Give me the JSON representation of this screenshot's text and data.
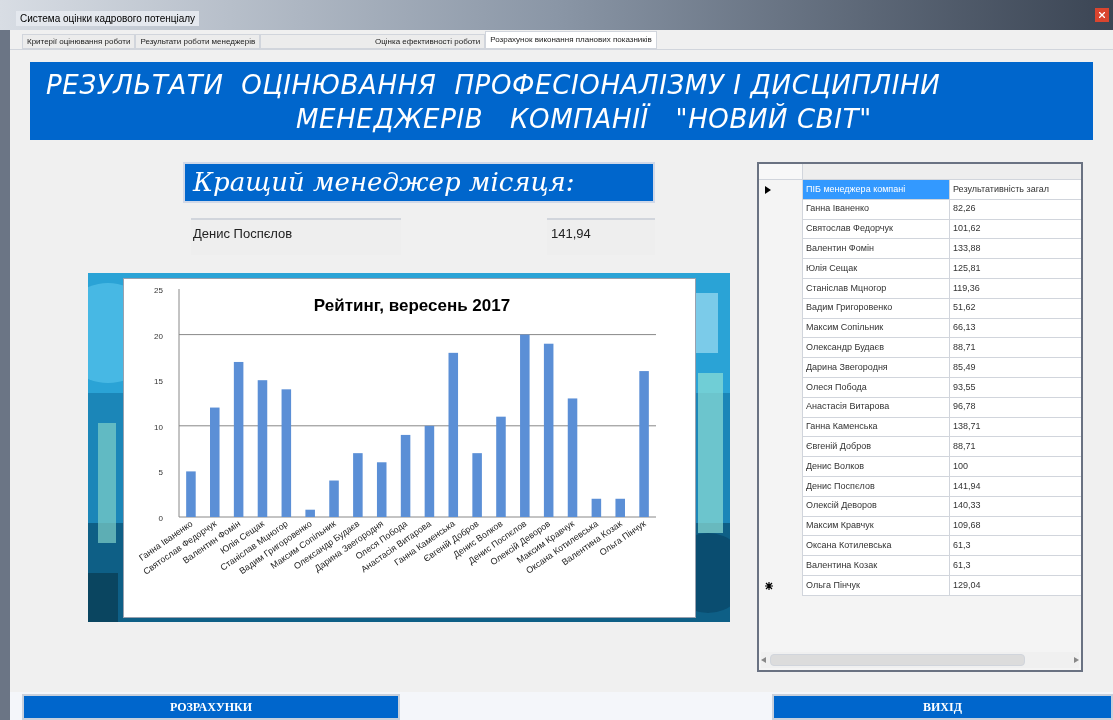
{
  "window": {
    "title": "Система оцінки кадрового потенціалу"
  },
  "tabs": [
    {
      "label": "Критерії оцінювання роботи",
      "selected": false
    },
    {
      "label": "Результати роботи менеджерів",
      "selected": false
    },
    {
      "label": "Оцінка ефективності роботи",
      "selected": false
    },
    {
      "label": "Розрахунок виконання планових показників",
      "selected": true
    }
  ],
  "banner": {
    "line_1": "РЕЗУЛЬТАТИ  ОЦІНЮВАННЯ  ПРОФЕСІОНАЛІЗМУ І ДИСЦИПЛІНИ",
    "line_2": "МЕНЕДЖЕРІВ   КОМПАНІЇ   \"НОВИЙ СВІТ\""
  },
  "best_manager": {
    "heading": "Кращий менеджер місяця:",
    "name": "Денис Поспєлов",
    "score": "141,94"
  },
  "chart": {
    "chart_data": {
      "type": "bar",
      "title": "Рейтинг, вересень 2017",
      "categories": [
        "Ганна Іваненко",
        "Святослав Федорчук",
        "Валентин Фомін",
        "Юлія Сещак",
        "Станіслав Мцногор",
        "Вадим Григоровенко",
        "Максим Сопільник",
        "Олександр Будаєв",
        "Дарина Звегородня",
        "Олеся Побода",
        "Анастасія Витарова",
        "Ганна Каменська",
        "Євгеній Добров",
        "Денис Волков",
        "Денис Поспєлов",
        "Олексій Деворов",
        "Максим Кравчук",
        "Оксана Котилевська",
        "Валентина Козак",
        "Ольга Пінчук"
      ],
      "series": [
        {
          "color": "#5b8fd6",
          "values": [
            5,
            12,
            17,
            15,
            14,
            0.8,
            4,
            7,
            6,
            9,
            10,
            18,
            7,
            11,
            20,
            19,
            13,
            2,
            2,
            16
          ]
        }
      ],
      "ylim": [
        0,
        25
      ],
      "yticks": [
        0,
        5,
        10,
        15,
        20,
        25
      ]
    }
  },
  "table": {
    "rows": [
      {
        "current": true,
        "new_row": false,
        "name": "ПІБ менеджера компані",
        "value": "Результативність загал",
        "selected": true
      },
      {
        "current": false,
        "new_row": false,
        "name": "Ганна Іваненко",
        "value": "82,26",
        "selected": false
      },
      {
        "current": false,
        "new_row": false,
        "name": "Святослав Федорчук",
        "value": "101,62",
        "selected": false
      },
      {
        "current": false,
        "new_row": false,
        "name": "Валентин Фомін",
        "value": "133,88",
        "selected": false
      },
      {
        "current": false,
        "new_row": false,
        "name": "Юлія Сещак",
        "value": "125,81",
        "selected": false
      },
      {
        "current": false,
        "new_row": false,
        "name": "Станіслав Мцногор",
        "value": "119,36",
        "selected": false
      },
      {
        "current": false,
        "new_row": false,
        "name": "Вадим Григоровенко",
        "value": "51,62",
        "selected": false
      },
      {
        "current": false,
        "new_row": false,
        "name": "Максим Сопільник",
        "value": "66,13",
        "selected": false
      },
      {
        "current": false,
        "new_row": false,
        "name": "Олександр Будаєв",
        "value": "88,71",
        "selected": false
      },
      {
        "current": false,
        "new_row": false,
        "name": "Дарина Звегородня",
        "value": "85,49",
        "selected": false
      },
      {
        "current": false,
        "new_row": false,
        "name": "Олеся Побода",
        "value": "93,55",
        "selected": false
      },
      {
        "current": false,
        "new_row": false,
        "name": "Анастасія Витарова",
        "value": "96,78",
        "selected": false
      },
      {
        "current": false,
        "new_row": false,
        "name": "Ганна Каменська",
        "value": "138,71",
        "selected": false
      },
      {
        "current": false,
        "new_row": false,
        "name": "Євгеній Добров",
        "value": "88,71",
        "selected": false
      },
      {
        "current": false,
        "new_row": false,
        "name": "Денис Волков",
        "value": "100",
        "selected": false
      },
      {
        "current": false,
        "new_row": false,
        "name": "Денис Поспєлов",
        "value": "141,94",
        "selected": false
      },
      {
        "current": false,
        "new_row": false,
        "name": "Олексій Деворов",
        "value": "140,33",
        "selected": false
      },
      {
        "current": false,
        "new_row": false,
        "name": "Максим Кравчук",
        "value": "109,68",
        "selected": false
      },
      {
        "current": false,
        "new_row": false,
        "name": "Оксана Котилевська",
        "value": "61,3",
        "selected": false
      },
      {
        "current": false,
        "new_row": false,
        "name": "Валентина Козак",
        "value": "61,3",
        "selected": false
      },
      {
        "current": false,
        "new_row": true,
        "name": "Ольга Пінчук",
        "value": "129,04",
        "selected": false
      }
    ]
  },
  "buttons": [
    {
      "label": "РОЗРАХУНКИ"
    },
    {
      "label": "ВИХІД"
    }
  ]
}
